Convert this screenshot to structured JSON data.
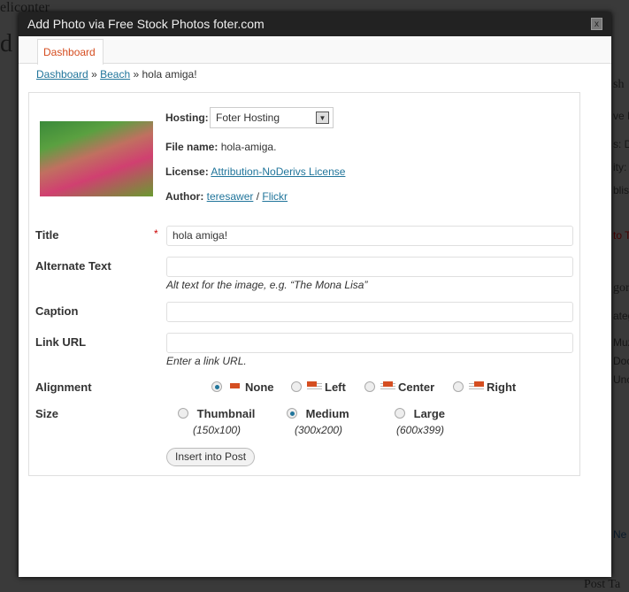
{
  "background": {
    "fragments": [
      "eliconter",
      "d",
      "sh",
      "ve P",
      "s: Dr",
      "ity: P",
      "blis",
      "to T",
      "gor",
      "ateg",
      "Muzy",
      "Doc",
      "Unc",
      "Ne",
      "Post Ta"
    ]
  },
  "dialog": {
    "title": "Add Photo via Free Stock Photos foter.com",
    "close_label": "x"
  },
  "tabs": [
    {
      "label": "Dashboard",
      "active": true
    }
  ],
  "breadcrumb": {
    "items": [
      "Dashboard",
      "Beach"
    ],
    "current": "hola amiga!",
    "separator": "»"
  },
  "photo": {
    "hosting_label": "Hosting:",
    "hosting_value": "Foter Hosting",
    "filename_label": "File name:",
    "filename": "hola-amiga.",
    "license_label": "License:",
    "license": "Attribution-NoDerivs License",
    "author_label": "Author:",
    "author": "teresawer",
    "author_sep": "/",
    "source": "Flickr"
  },
  "form": {
    "title_label": "Title",
    "required": "*",
    "title_value": "hola amiga!",
    "alt_label": "Alternate Text",
    "alt_value": "",
    "alt_hint": "Alt text for the image, e.g. “The Mona Lisa”",
    "caption_label": "Caption",
    "caption_value": "",
    "link_label": "Link URL",
    "link_value": "",
    "link_hint": "Enter a link URL.",
    "alignment_label": "Alignment",
    "alignment": [
      {
        "label": "None",
        "checked": true
      },
      {
        "label": "Left",
        "checked": false
      },
      {
        "label": "Center",
        "checked": false
      },
      {
        "label": "Right",
        "checked": false
      }
    ],
    "size_label": "Size",
    "sizes": [
      {
        "label": "Thumbnail",
        "dims": "(150x100)",
        "checked": false
      },
      {
        "label": "Medium",
        "dims": "(300x200)",
        "checked": true
      },
      {
        "label": "Large",
        "dims": "(600x399)",
        "checked": false
      }
    ],
    "submit_label": "Insert into Post"
  },
  "colors": {
    "accent": "#d54e21",
    "link": "#21759b",
    "titlebar": "#222222"
  }
}
